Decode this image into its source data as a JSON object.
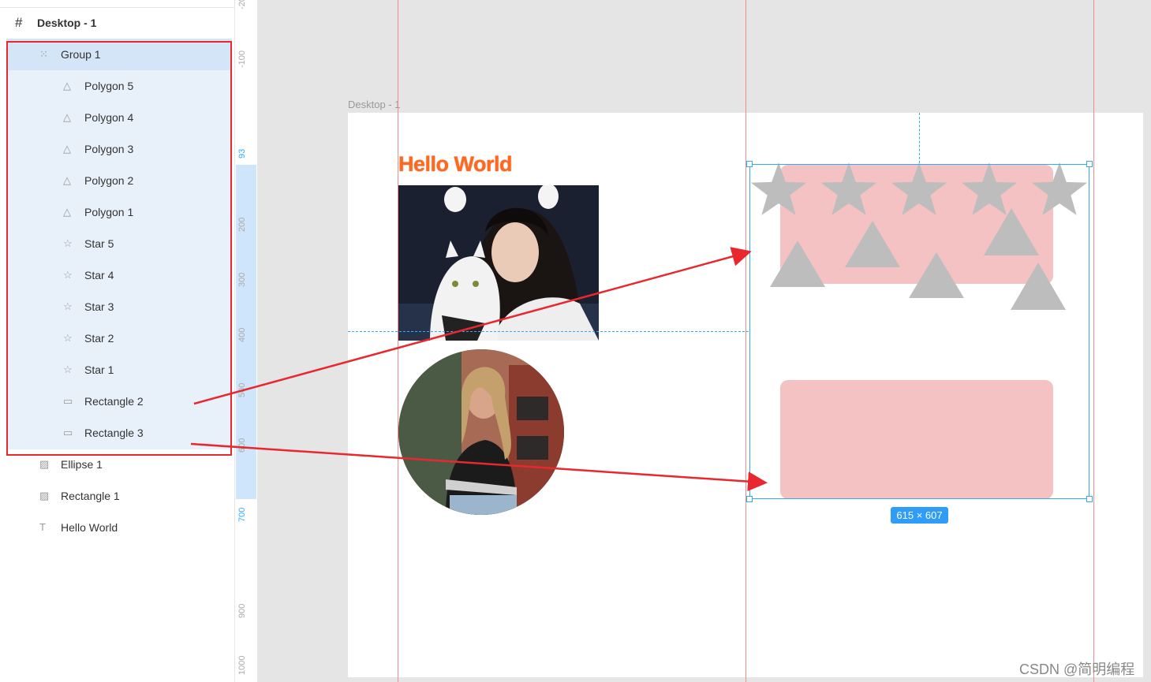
{
  "layers": {
    "frame": {
      "icon": "frame-hash-icon",
      "label": "Desktop - 1"
    },
    "group": {
      "icon": "group-dotted-icon",
      "label": "Group 1"
    },
    "children": [
      {
        "icon": "triangle-icon",
        "label": "Polygon 5"
      },
      {
        "icon": "triangle-icon",
        "label": "Polygon 4"
      },
      {
        "icon": "triangle-icon",
        "label": "Polygon 3"
      },
      {
        "icon": "triangle-icon",
        "label": "Polygon 2"
      },
      {
        "icon": "triangle-icon",
        "label": "Polygon 1"
      },
      {
        "icon": "star-icon",
        "label": "Star 5"
      },
      {
        "icon": "star-icon",
        "label": "Star 4"
      },
      {
        "icon": "star-icon",
        "label": "Star 3"
      },
      {
        "icon": "star-icon",
        "label": "Star 2"
      },
      {
        "icon": "star-icon",
        "label": "Star 1"
      },
      {
        "icon": "rectangle-icon",
        "label": "Rectangle 2"
      },
      {
        "icon": "rectangle-icon",
        "label": "Rectangle 3"
      }
    ],
    "others": [
      {
        "icon": "image-icon",
        "label": "Ellipse 1"
      },
      {
        "icon": "image-icon",
        "label": "Rectangle 1"
      },
      {
        "icon": "text-icon",
        "label": "Hello World"
      }
    ]
  },
  "ruler": {
    "ticks": [
      "-20",
      "-100",
      "93",
      "200",
      "300",
      "400",
      "500",
      "600",
      "700",
      "900",
      "1000"
    ],
    "highlight_start": "93",
    "highlight_end": "700"
  },
  "canvas": {
    "frame_label": "Desktop - 1",
    "hello_text": "Hello World",
    "size_badge": "615 × 607"
  },
  "colors": {
    "selection": "#35a7ff",
    "guide": "#f28b8b",
    "annotation": "#e8282e",
    "rect_fill": "#f4c2c2",
    "shape_fill": "#bdbdbd",
    "hello_text": "#ff6a1a"
  },
  "watermark": "CSDN @简明编程"
}
